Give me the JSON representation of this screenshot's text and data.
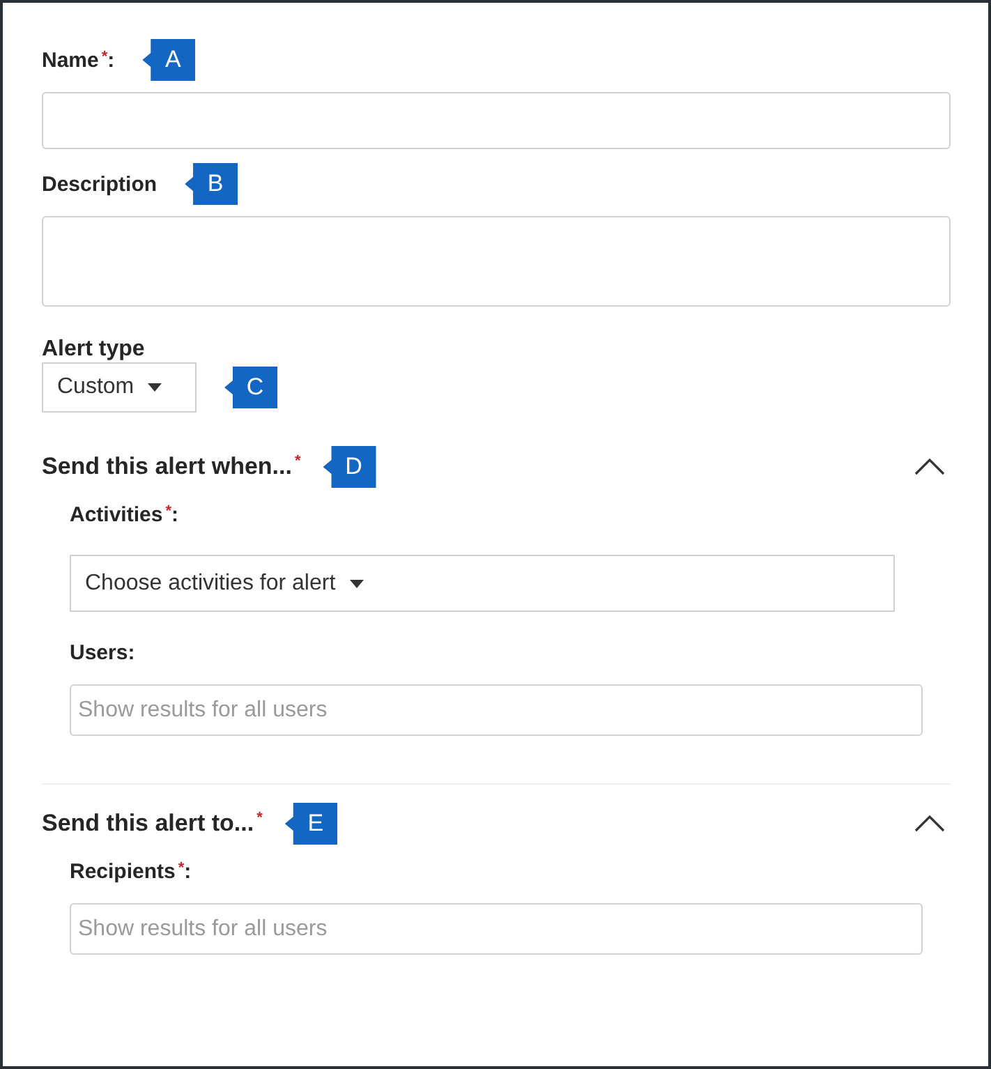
{
  "fields": [
    {
      "kind": "text",
      "label": "Name",
      "mark": "*",
      "suffix": ":",
      "callout": "A"
    },
    {
      "kind": "textarea",
      "label": "Description",
      "callout": "B"
    },
    {
      "kind": "select",
      "label": "Alert type",
      "value": "Custom",
      "callout": "C"
    }
  ],
  "sections": [
    {
      "title": "Send this alert when...",
      "mark": "*",
      "expanded": true,
      "callout": "D",
      "fields": [
        {
          "kind": "wideselect",
          "label": "Activities",
          "mark": "*",
          "suffix": ":",
          "value": "Choose activities for alert"
        },
        {
          "kind": "search",
          "label": "Users:",
          "placeholder": "Show results for all users"
        }
      ]
    },
    {
      "title": "Send this alert to...",
      "mark": "*",
      "expanded": true,
      "callout": "E",
      "fields": [
        {
          "kind": "search",
          "label": "Recipients",
          "mark": "*",
          "suffix": ":",
          "placeholder": "Show results for all users"
        }
      ]
    }
  ]
}
